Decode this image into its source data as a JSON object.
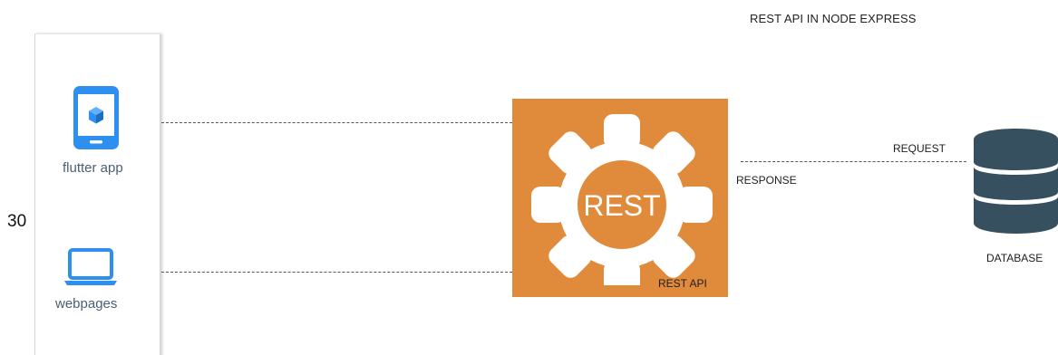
{
  "diagram": {
    "title": "REST API IN NODE EXPRESS",
    "stray_text": "30"
  },
  "clients": [
    {
      "label": "flutter app",
      "icon": "mobile-app-icon"
    },
    {
      "label": "webpages",
      "icon": "laptop-icon"
    }
  ],
  "rest": {
    "gear_text": "REST",
    "caption": "REST API",
    "icon": "gear-icon"
  },
  "flow": {
    "request_label": "REQUEST",
    "response_label": "RESPONSE"
  },
  "database": {
    "label": "DATABASE",
    "icon": "database-icon"
  },
  "colors": {
    "rest_box": "#e08a3c",
    "client_icon_blue": "#2d8ff0",
    "database": "#37505f",
    "client_label": "#4a5f73"
  }
}
